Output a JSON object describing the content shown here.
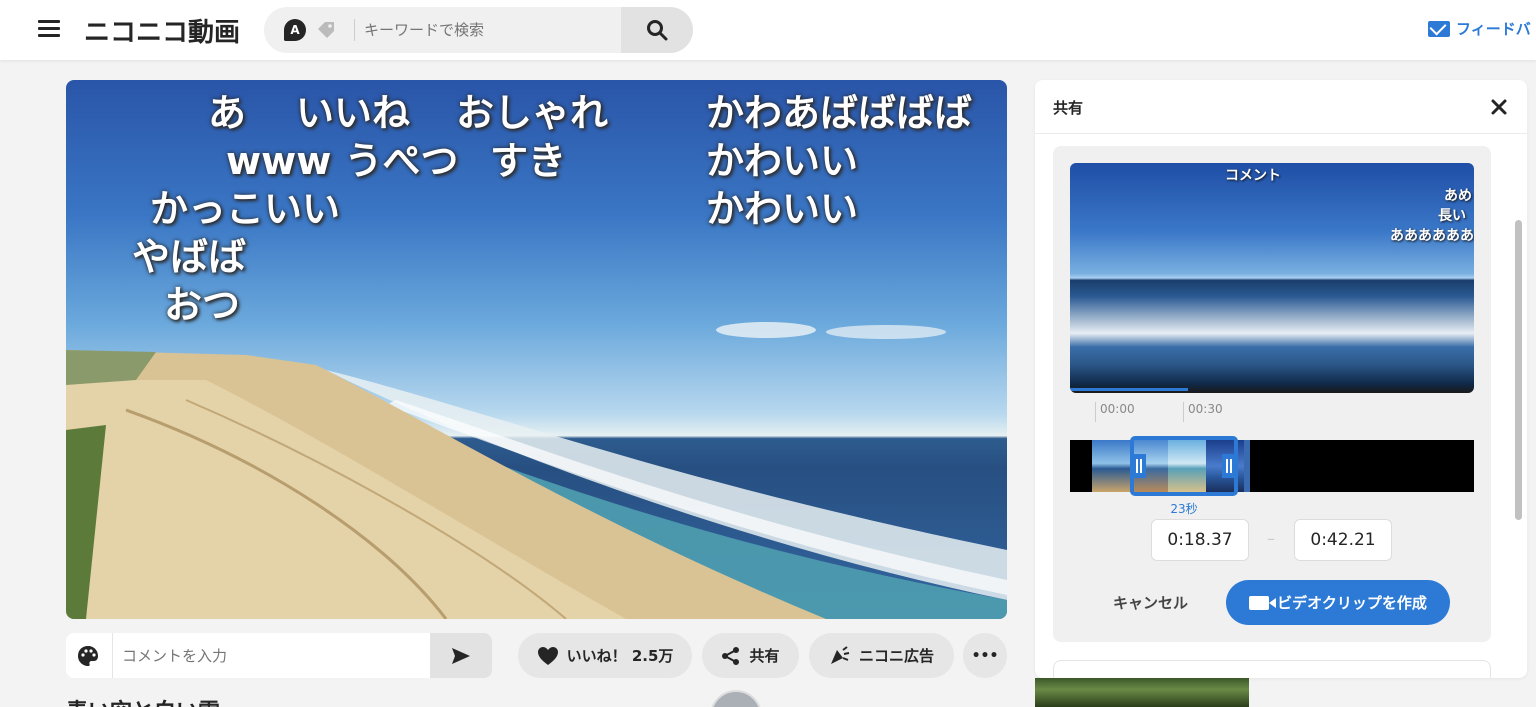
{
  "header": {
    "logo_text": "ニコニコ動画",
    "ai_badge": "A",
    "search_placeholder": "キーワードで検索",
    "feedback_label": "フィードバ"
  },
  "video": {
    "comments": [
      {
        "text": "あ",
        "row": 1
      },
      {
        "text": "いいね",
        "row": 1
      },
      {
        "text": "おしゃれ",
        "row": 1
      },
      {
        "text": "かわあばばばば",
        "row": 1
      },
      {
        "text": "www うぺつ",
        "row": 2
      },
      {
        "text": "すき",
        "row": 2
      },
      {
        "text": "かわいい",
        "row": 2
      },
      {
        "text": "かっこいい",
        "row": 3
      },
      {
        "text": "かわいい",
        "row": 3
      },
      {
        "text": "やばば",
        "row": 4
      },
      {
        "text": "おつ",
        "row": 5
      }
    ]
  },
  "comment_bar": {
    "placeholder": "コメントを入力"
  },
  "actions": {
    "like_label": "いいね！ 2.5万",
    "share_label": "共有",
    "ad_label": "ニコニ広告",
    "more_label": "•••"
  },
  "below": {
    "title": "青い空と白い雲"
  },
  "share_panel": {
    "title": "共有",
    "preview_comments": [
      "コメント",
      "あめ",
      "長い",
      "ああああああ"
    ],
    "tick_start": "00:00",
    "tick_mid": "00:30",
    "duration": "23秒",
    "start_time": "0:18.37",
    "end_time": "0:42.21",
    "separator": "–",
    "cancel_label": "キャンセル",
    "create_label": "ビデオクリップを作成"
  },
  "colors": {
    "accent": "#2c7ad6",
    "pill_bg": "#e6e6e6",
    "page_bg": "#f3f3f3"
  }
}
